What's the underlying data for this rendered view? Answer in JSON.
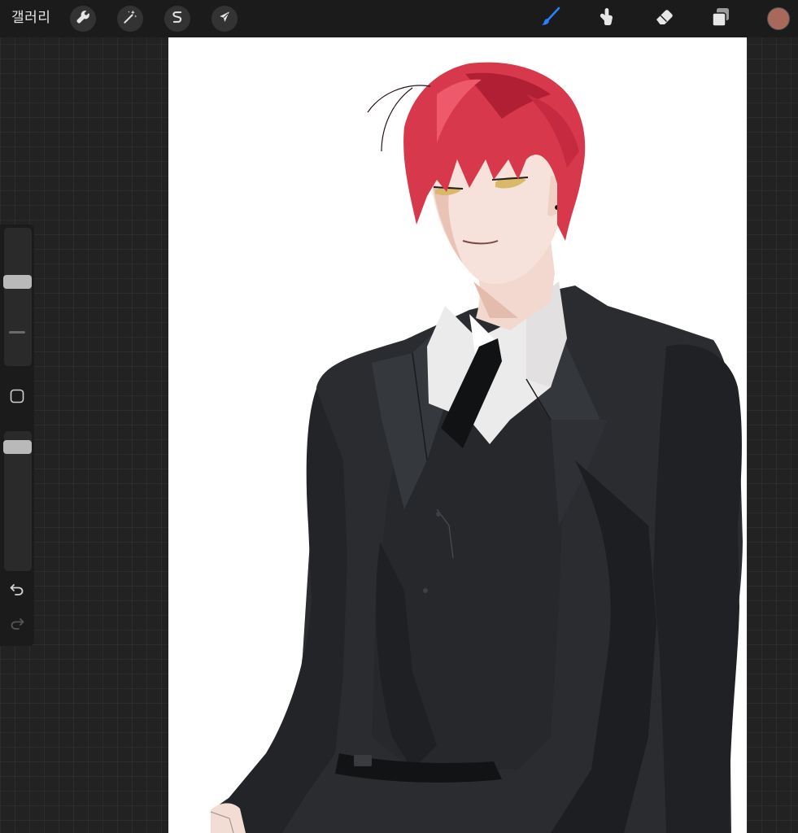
{
  "topbar": {
    "gallery_label": "갤러리",
    "left_tools": [
      {
        "name": "actions",
        "icon": "wrench-icon"
      },
      {
        "name": "adjustments",
        "icon": "magic-wand-icon"
      },
      {
        "name": "selection",
        "icon": "selection-s-icon"
      },
      {
        "name": "transform",
        "icon": "arrow-cursor-icon"
      }
    ],
    "right_tools": [
      {
        "name": "brush",
        "icon": "brush-icon",
        "active": true
      },
      {
        "name": "smudge",
        "icon": "smudge-finger-icon",
        "active": false
      },
      {
        "name": "eraser",
        "icon": "eraser-icon",
        "active": false
      },
      {
        "name": "layers",
        "icon": "layers-icon",
        "active": false
      }
    ],
    "active_color": "#a8695a"
  },
  "colors": {
    "accent": "#2a7fff",
    "bar_bg": "#1b1b1b",
    "canvas_bg": "#ffffff",
    "hair": "#d8384b",
    "suit": "#2a2c30"
  },
  "sidebar": {
    "brush_size": 0.62,
    "brush_opacity": 0.93,
    "modify_icon": "square-modify-icon",
    "undo_icon": "undo-icon",
    "redo_icon": "redo-icon",
    "redo_enabled": false
  }
}
